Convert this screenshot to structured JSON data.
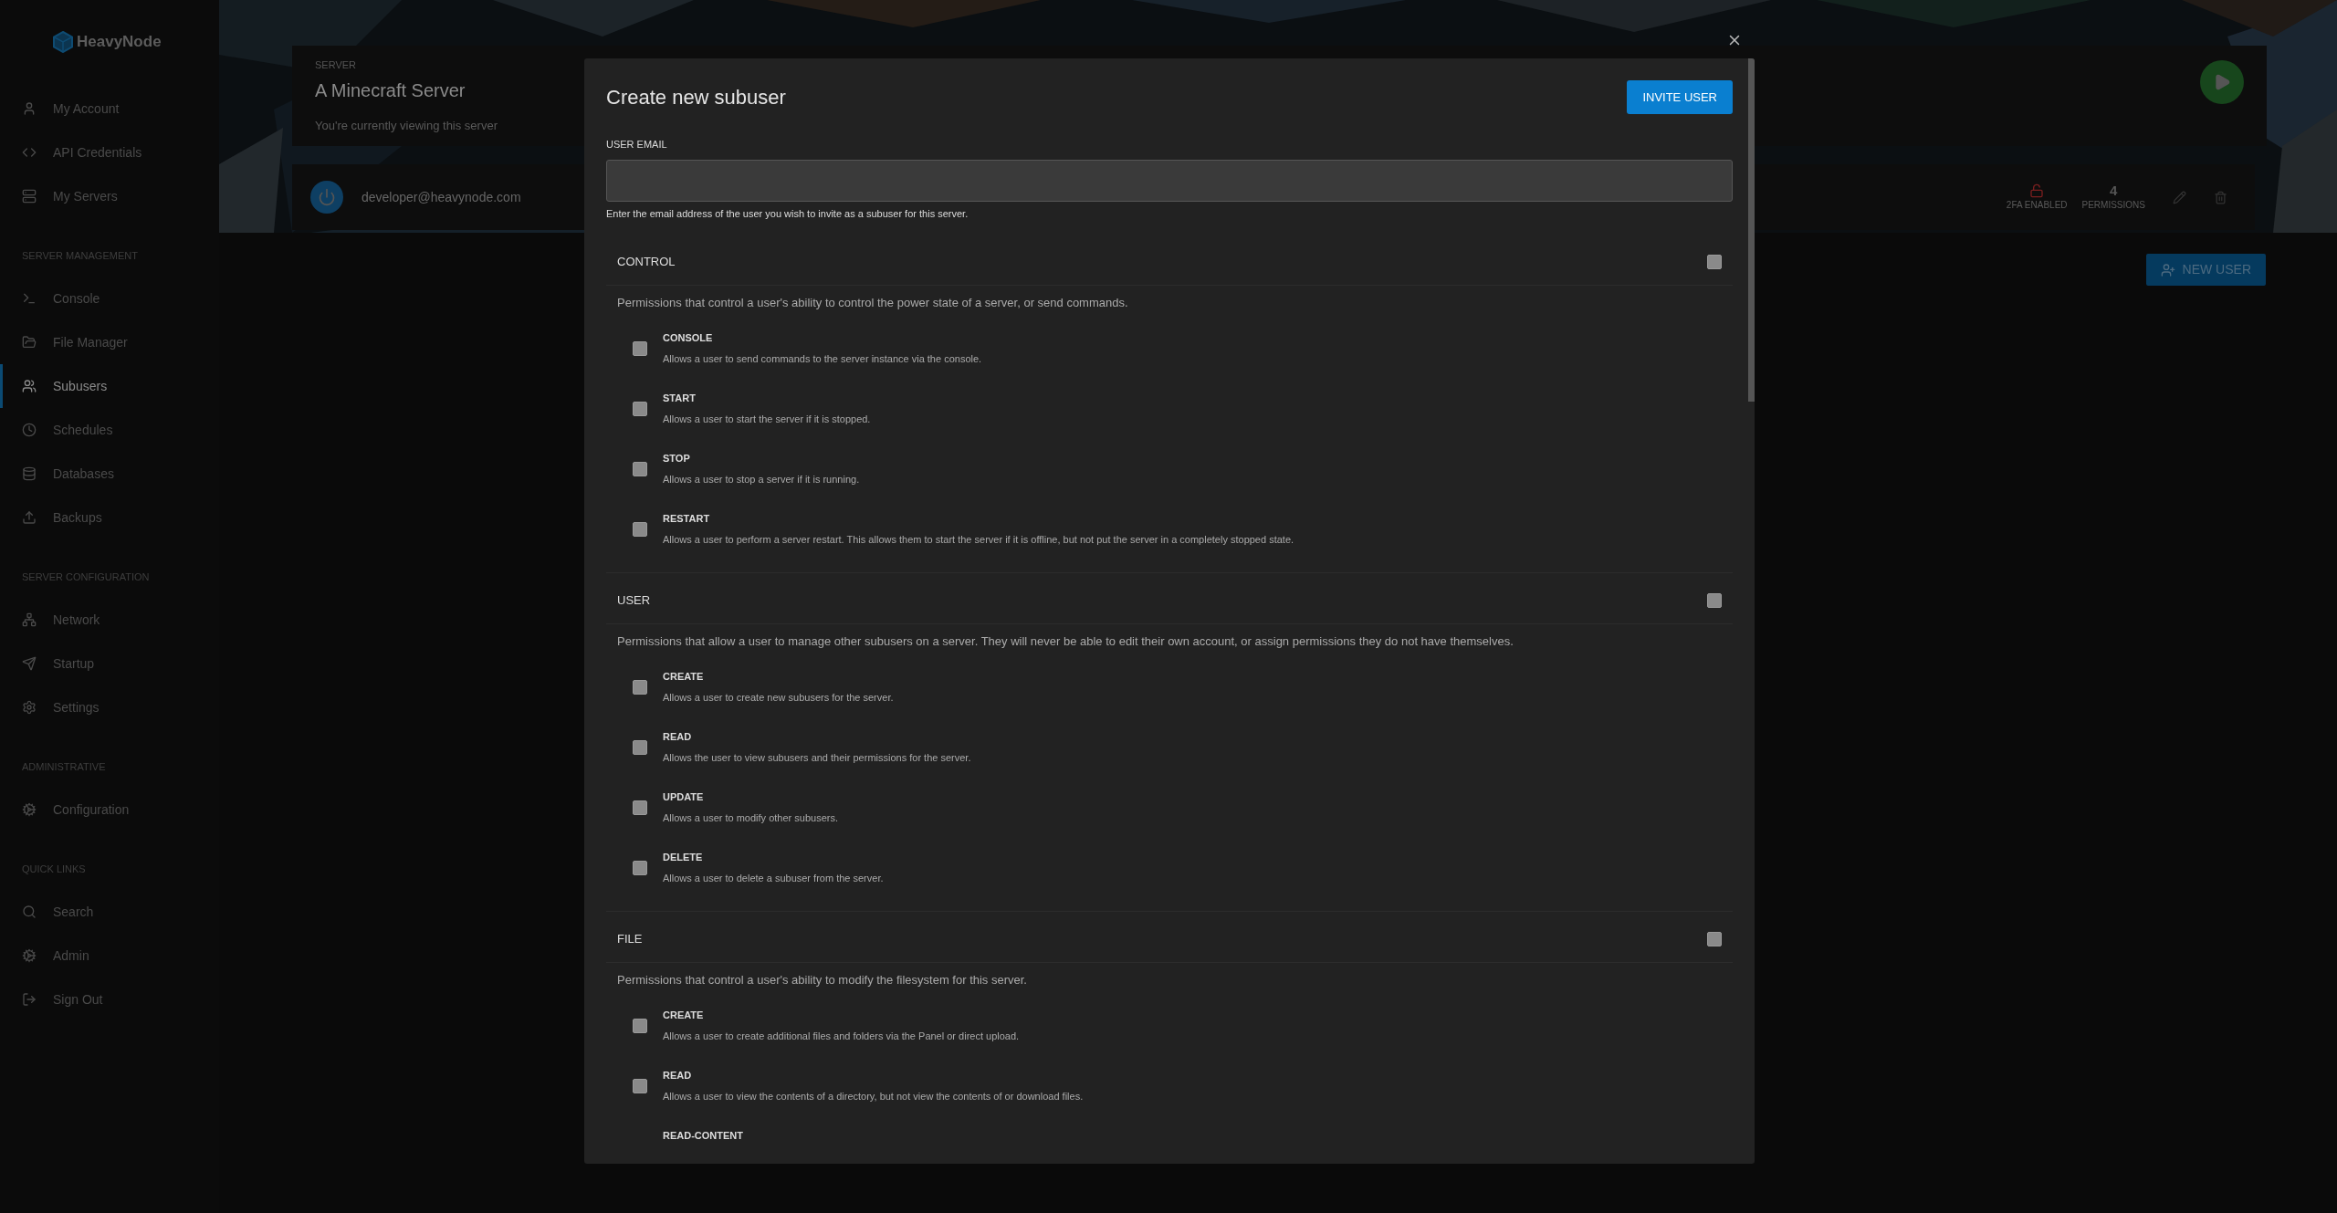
{
  "sidebar": {
    "brand": "HeavyNode",
    "sections": [
      {
        "items": [
          {
            "label": "My Account",
            "selected": false
          },
          {
            "label": "API Credentials",
            "selected": false
          },
          {
            "label": "My Servers",
            "selected": false
          }
        ]
      },
      {
        "title": "SERVER MANAGEMENT",
        "items": [
          {
            "label": "Console",
            "selected": false
          },
          {
            "label": "File Manager",
            "selected": false
          },
          {
            "label": "Subusers",
            "selected": true
          },
          {
            "label": "Schedules",
            "selected": false
          },
          {
            "label": "Databases",
            "selected": false
          },
          {
            "label": "Backups",
            "selected": false
          }
        ]
      },
      {
        "title": "SERVER CONFIGURATION",
        "items": [
          {
            "label": "Network",
            "selected": false
          },
          {
            "label": "Startup",
            "selected": false
          },
          {
            "label": "Settings",
            "selected": false
          }
        ]
      },
      {
        "title": "ADMINISTRATIVE",
        "items": [
          {
            "label": "Configuration",
            "selected": false
          }
        ]
      },
      {
        "title": "QUICK LINKS",
        "items": [
          {
            "label": "Search",
            "selected": false
          },
          {
            "label": "Admin",
            "selected": false
          },
          {
            "label": "Sign Out",
            "selected": false
          }
        ]
      }
    ]
  },
  "server_header": {
    "label": "SERVER",
    "name": "A Minecraft Server",
    "subtitle": "You're currently viewing this server"
  },
  "subuser": {
    "email": "developer@heavynode.com",
    "two_factor_label": "2FA ENABLED",
    "permissions_count": "4",
    "permissions_label": "PERMISSIONS"
  },
  "new_user_button": "NEW USER",
  "modal": {
    "title": "Create new subuser",
    "invite_button": "INVITE USER",
    "email_label": "USER EMAIL",
    "email_help": "Enter the email address of the user you wish to invite as a subuser for this server.",
    "sections": [
      {
        "title": "CONTROL",
        "checked": false,
        "description": "Permissions that control a user's ability to control the power state of a server, or send commands.",
        "permissions": [
          {
            "name": "CONSOLE",
            "description": "Allows a user to send commands to the server instance via the console.",
            "checked": false
          },
          {
            "name": "START",
            "description": "Allows a user to start the server if it is stopped.",
            "checked": false
          },
          {
            "name": "STOP",
            "description": "Allows a user to stop a server if it is running.",
            "checked": false
          },
          {
            "name": "RESTART",
            "description": "Allows a user to perform a server restart. This allows them to start the server if it is offline, but not put the server in a completely stopped state.",
            "checked": false
          }
        ]
      },
      {
        "title": "USER",
        "checked": false,
        "description": "Permissions that allow a user to manage other subusers on a server. They will never be able to edit their own account, or assign permissions they do not have themselves.",
        "permissions": [
          {
            "name": "CREATE",
            "description": "Allows a user to create new subusers for the server.",
            "checked": false
          },
          {
            "name": "READ",
            "description": "Allows the user to view subusers and their permissions for the server.",
            "checked": false
          },
          {
            "name": "UPDATE",
            "description": "Allows a user to modify other subusers.",
            "checked": false
          },
          {
            "name": "DELETE",
            "description": "Allows a user to delete a subuser from the server.",
            "checked": false
          }
        ]
      },
      {
        "title": "FILE",
        "checked": false,
        "description": "Permissions that control a user's ability to modify the filesystem for this server.",
        "permissions": [
          {
            "name": "CREATE",
            "description": "Allows a user to create additional files and folders via the Panel or direct upload.",
            "checked": false
          },
          {
            "name": "READ",
            "description": "Allows a user to view the contents of a directory, but not view the contents of or download files.",
            "checked": false
          },
          {
            "name": "READ-CONTENT"
          }
        ]
      }
    ]
  }
}
